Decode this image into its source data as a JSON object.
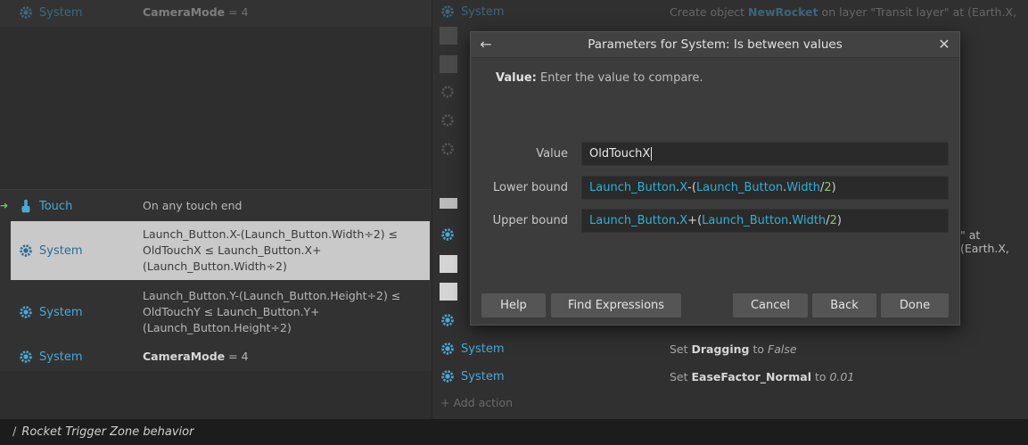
{
  "conditions": {
    "top_row": {
      "object": "System",
      "text_bold": "CameraMode",
      "text_rest": " = 4"
    },
    "rows": [
      {
        "object": "Touch",
        "text": "On any touch end"
      },
      {
        "object": "System",
        "text": "Launch_Button.X-(Launch_Button.Width÷2) ≤ OldTouchX ≤ Launch_Button.X+(Launch_Button.Width÷2)"
      },
      {
        "object": "System",
        "text": "Launch_Button.Y-(Launch_Button.Height÷2) ≤ OldTouchY ≤ Launch_Button.Y+(Launch_Button.Height÷2)"
      },
      {
        "object": "System",
        "text_bold": "CameraMode",
        "text_rest": " = 4"
      }
    ]
  },
  "actions": {
    "top_obj": "System",
    "top_text_prefix": "Create object",
    "top_text_bold": "NewRocket",
    "top_text_suffix": "on layer \"Transit layer\" at (Earth.X,",
    "mid_fragment": "\" at (Earth.X,",
    "rows": [
      {
        "object": "System",
        "text_prefix": "Set ",
        "text_bold": "Dragging",
        "text_mid": " to ",
        "text_italic": "False"
      },
      {
        "object": "System",
        "text_prefix": "Set ",
        "text_bold": "EaseFactor_Normal",
        "text_mid": " to ",
        "text_italic": "0.01"
      }
    ],
    "add_action": "Add action"
  },
  "bottom_bar": {
    "title": "Rocket Trigger Zone behavior"
  },
  "dialog": {
    "title": "Parameters for System: Is between values",
    "desc_label": "Value:",
    "desc_text": "Enter the value to compare.",
    "fields": {
      "value_label": "Value",
      "value_text": "OldTouchX",
      "lower_label": "Lower bound",
      "lower_tokens": [
        "Launch_Button",
        ".",
        "X",
        "-(",
        "Launch_Button",
        ".",
        "Width",
        "/",
        "2",
        ")"
      ],
      "upper_label": "Upper bound",
      "upper_tokens": [
        "Launch_Button",
        ".",
        "X",
        "+(",
        "Launch_Button",
        ".",
        "Width",
        "/",
        "2",
        ")"
      ]
    },
    "buttons": {
      "help": "Help",
      "find": "Find Expressions",
      "cancel": "Cancel",
      "back": "Back",
      "done": "Done"
    }
  }
}
